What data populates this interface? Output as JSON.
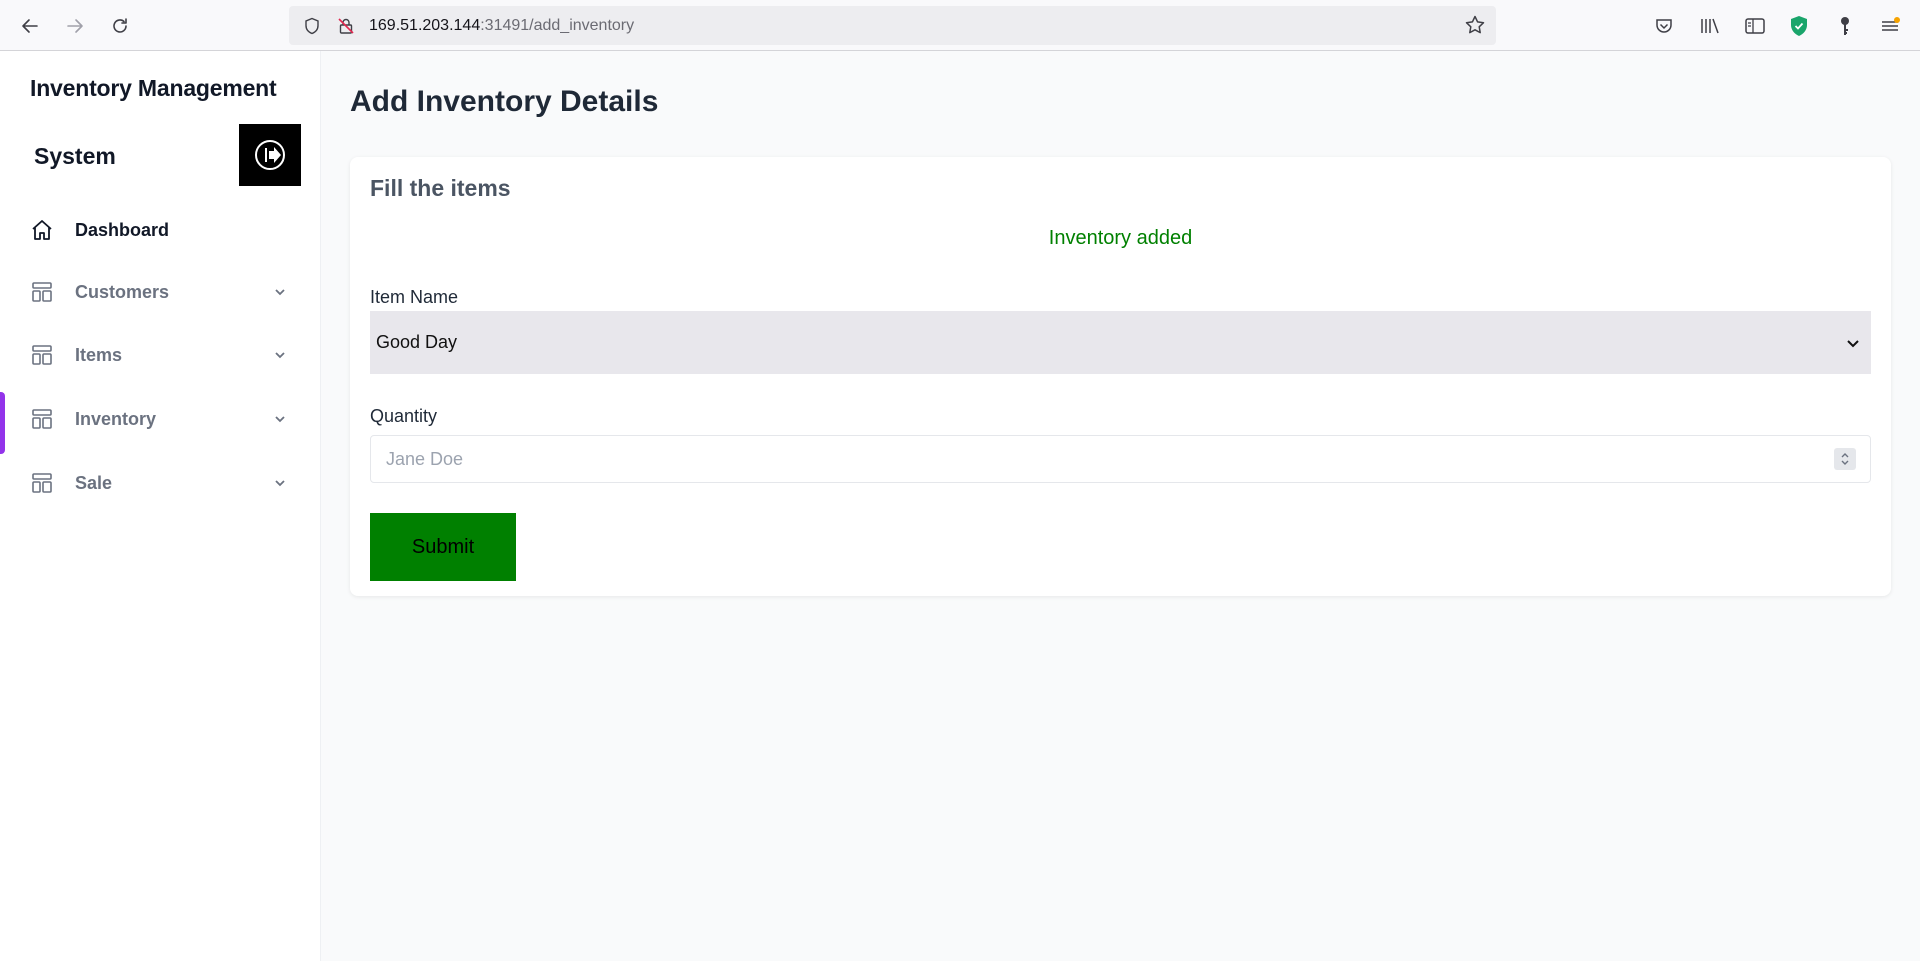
{
  "browser": {
    "url_host": "169.51.203.144",
    "url_path": ":31491/add_inventory"
  },
  "sidebar": {
    "brand_line1": "Inventory Management",
    "brand_line2": "System",
    "items": [
      {
        "label": "Dashboard",
        "icon": "home-icon",
        "active": true,
        "has_chevron": false
      },
      {
        "label": "Customers",
        "icon": "layout-icon",
        "active": false,
        "has_chevron": true
      },
      {
        "label": "Items",
        "icon": "layout-icon",
        "active": false,
        "has_chevron": true
      },
      {
        "label": "Inventory",
        "icon": "layout-icon",
        "active": false,
        "has_chevron": true,
        "indicator": true
      },
      {
        "label": "Sale",
        "icon": "layout-icon",
        "active": false,
        "has_chevron": true
      }
    ]
  },
  "main": {
    "title": "Add Inventory Details",
    "card_title": "Fill the items",
    "status_message": "Inventory added",
    "item_name_label": "Item Name",
    "item_name_value": "Good Day",
    "quantity_label": "Quantity",
    "quantity_placeholder": "Jane Doe",
    "submit_label": "Submit"
  },
  "colors": {
    "success": "#008000",
    "indicator": "#9333ea",
    "select_bg": "#e8e7ec"
  }
}
